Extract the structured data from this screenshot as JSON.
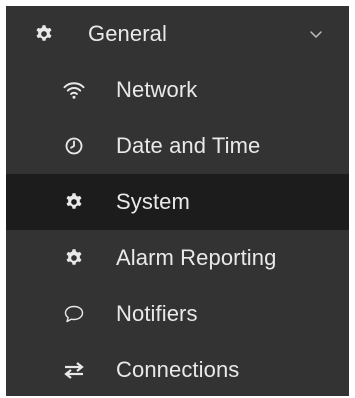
{
  "menu": {
    "header": {
      "label": "General",
      "icon": "gear-icon",
      "expanded": true,
      "chevron_icon": "chevron-down-icon"
    },
    "items": [
      {
        "label": "Network",
        "icon": "wifi-icon",
        "active": false
      },
      {
        "label": "Date and Time",
        "icon": "clock-icon",
        "active": false
      },
      {
        "label": "System",
        "icon": "gear-icon",
        "active": true
      },
      {
        "label": "Alarm Reporting",
        "icon": "gear-icon",
        "active": false
      },
      {
        "label": "Notifiers",
        "icon": "speech-bubble-icon",
        "active": false
      },
      {
        "label": "Connections",
        "icon": "exchange-arrows-icon",
        "active": false
      }
    ]
  },
  "colors": {
    "menu_background": "#333333",
    "active_background": "#1c1c1c",
    "text": "#e9e9e9",
    "page_background": "#ffffff"
  }
}
